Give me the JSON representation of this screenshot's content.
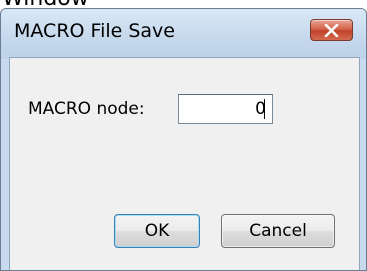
{
  "background": {
    "caption": "Window"
  },
  "dialog": {
    "title": "MACRO File Save",
    "close_icon": "close-x-icon"
  },
  "form": {
    "label": "MACRO node:",
    "node_value": "0"
  },
  "buttons": {
    "ok_label": "OK",
    "cancel_label": "Cancel"
  },
  "colors": {
    "titlebar": "#c5d8ec",
    "close_button": "#c0432b",
    "client_background": "#f0f0f0",
    "default_button_border": "#3c7fb1"
  }
}
